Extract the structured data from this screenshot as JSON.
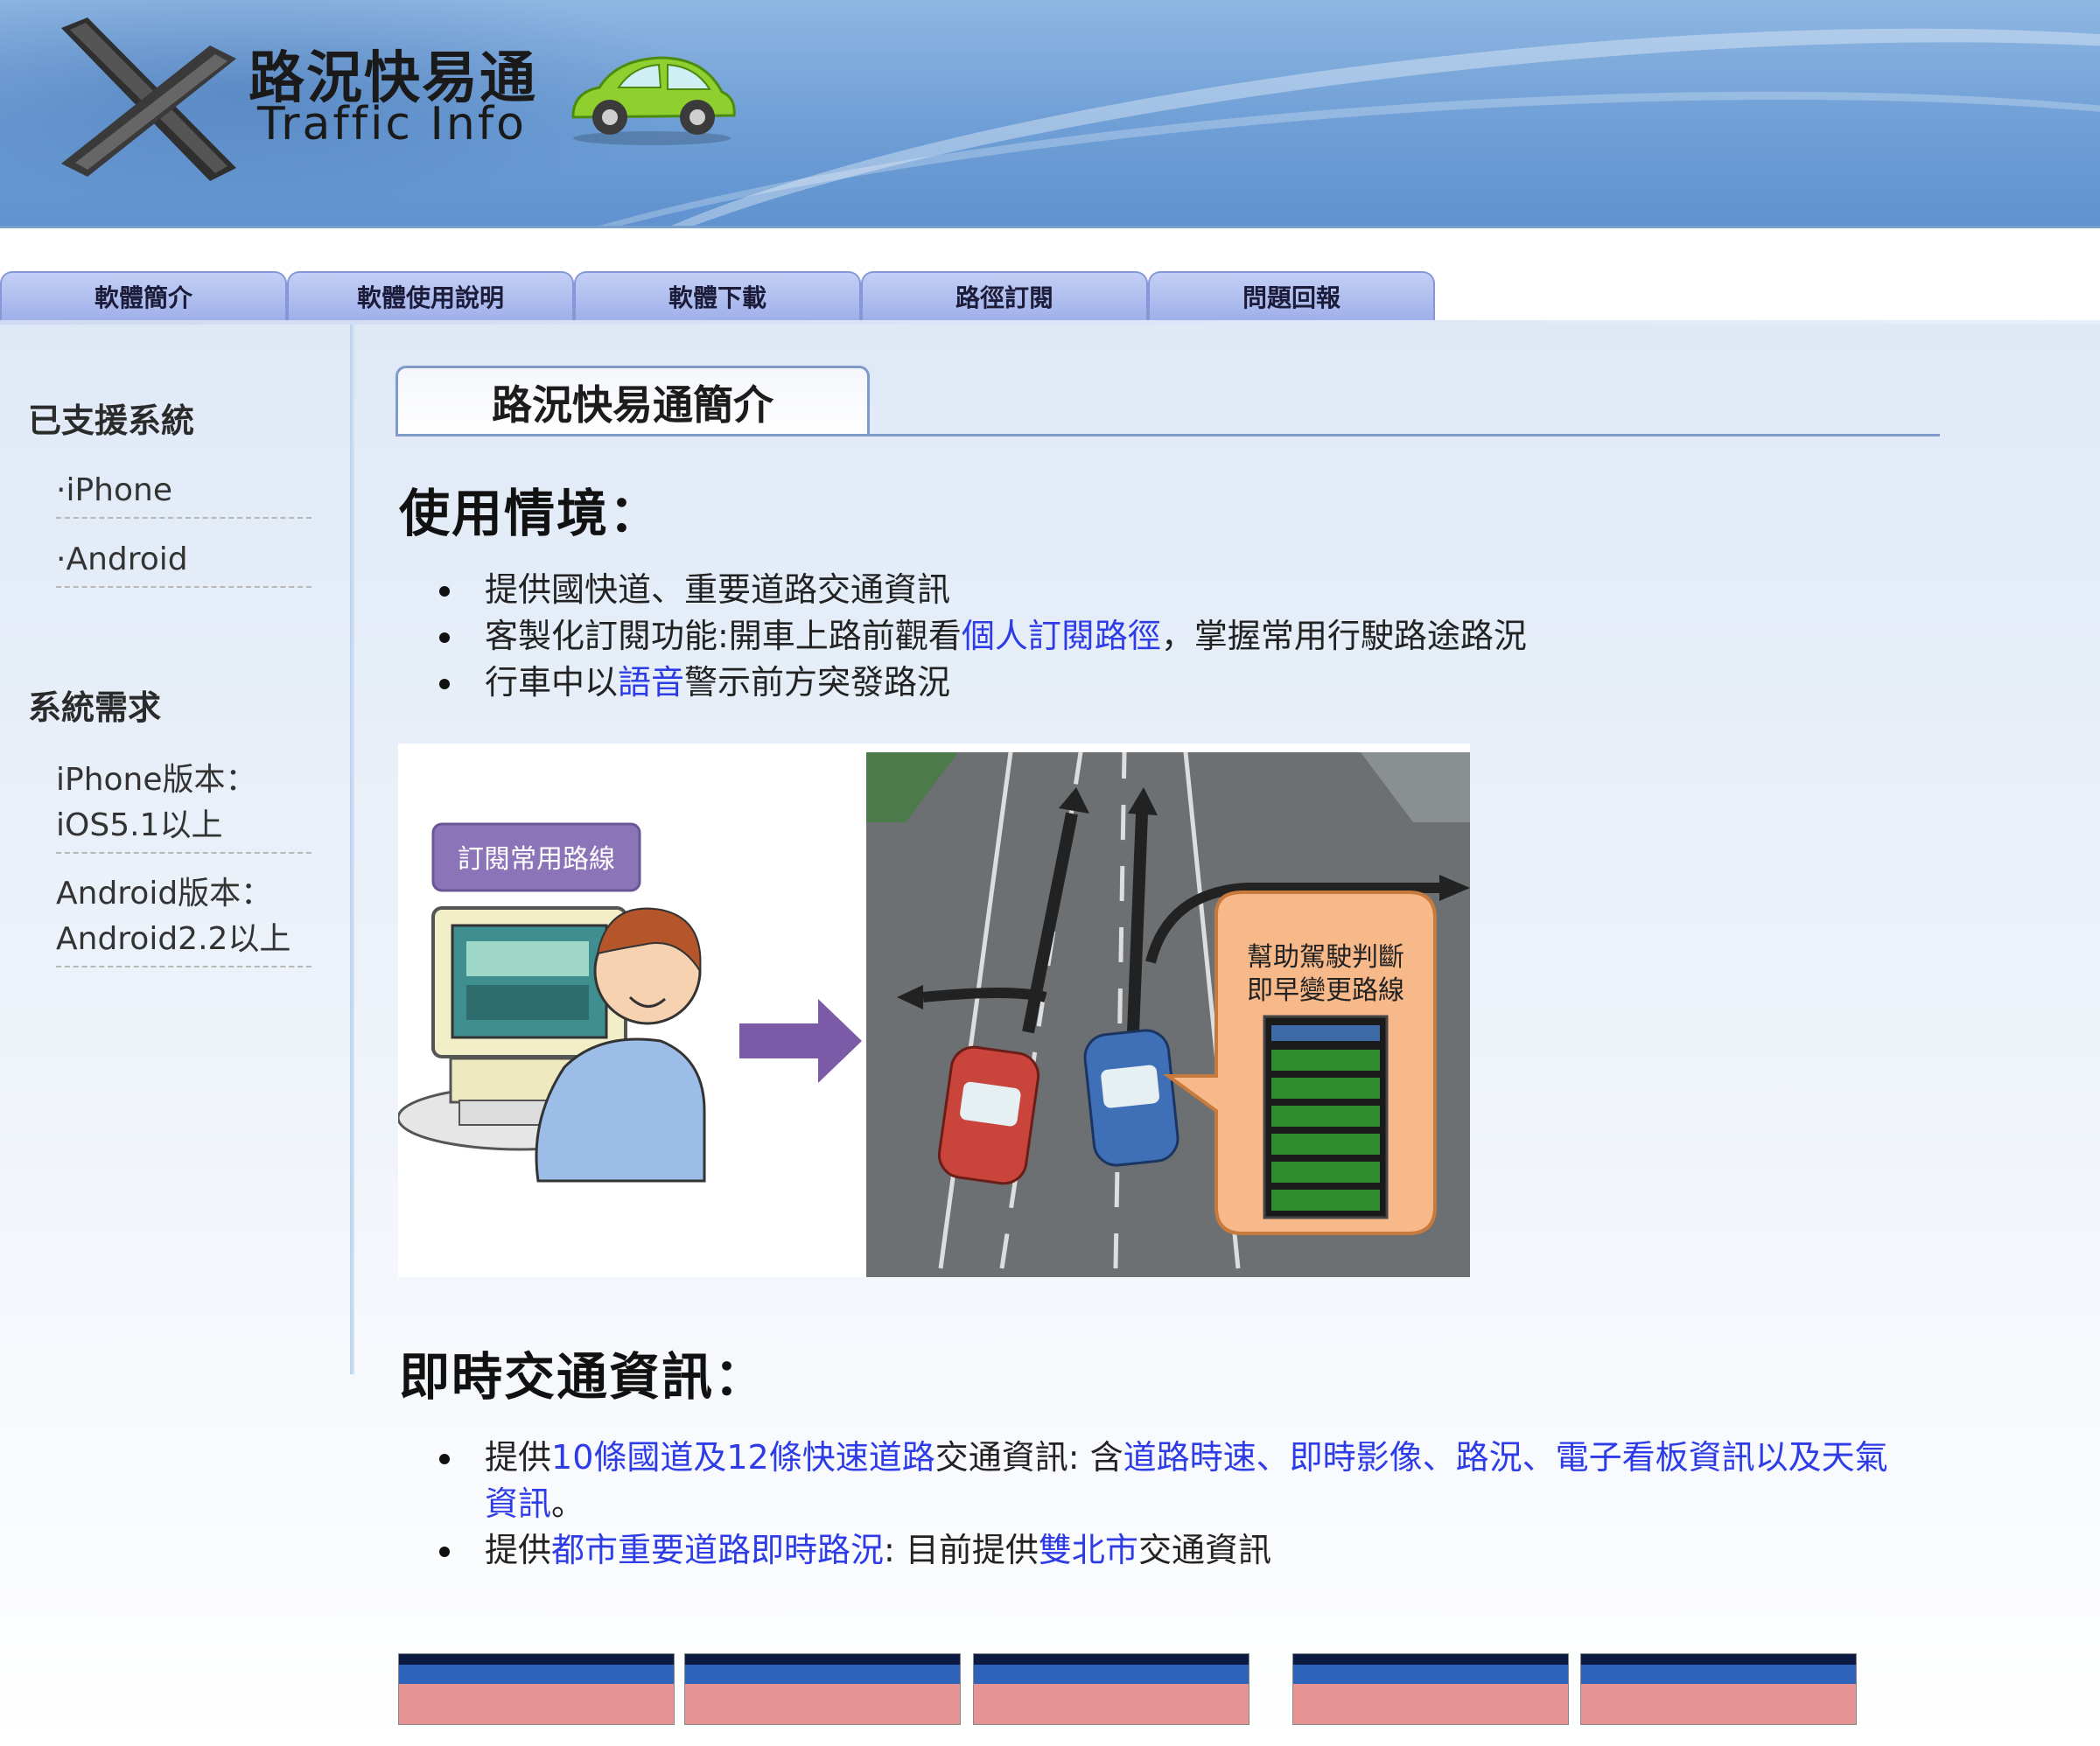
{
  "header": {
    "logo_cn": "路況快易通",
    "logo_en": "Traffic Info"
  },
  "nav": {
    "tabs": [
      {
        "label": "軟體簡介"
      },
      {
        "label": "軟體使用說明"
      },
      {
        "label": "軟體下載"
      },
      {
        "label": "路徑訂閱"
      },
      {
        "label": "問題回報"
      }
    ]
  },
  "sidebar": {
    "supported_heading": "已支援系統",
    "supported_items": [
      "·iPhone",
      "·Android"
    ],
    "requirements_heading": "系統需求",
    "requirements": [
      {
        "line1": "iPhone版本：",
        "line2": "iOS5.1以上"
      },
      {
        "line1": "Android版本：",
        "line2": "Android2.2以上"
      }
    ]
  },
  "main": {
    "title": "路況快易通簡介",
    "section1": {
      "heading": "使用情境：",
      "b1": "提供國快道、重要道路交通資訊",
      "b2_pre": "客製化訂閱功能:開車上路前觀看",
      "b2_link": "個人訂閱路徑",
      "b2_post": "，掌握常用行駛路途路況",
      "b3_pre": "行車中以",
      "b3_link": "語音",
      "b3_post": "警示前方突發路況"
    },
    "illustration": {
      "subscribe_label": "訂閱常用路線",
      "bubble_line1": "幫助駕駛判斷",
      "bubble_line2": "即早變更路線"
    },
    "section2": {
      "heading": "即時交通資訊：",
      "b1_pre": "提供",
      "b1_link1": "10條國道及12條快速道路",
      "b1_mid": "交通資訊: 含",
      "b1_link2": "道路時速、即時影像、路況、電子看板資訊以及天氣",
      "b1_link3": "資訊",
      "b1_end": "。",
      "b2_pre": "提供",
      "b2_link1": "都市重要道路即時路況",
      "b2_mid": ": 目前提供",
      "b2_link2": "雙北市",
      "b2_post": "交通資訊"
    }
  },
  "colors": {
    "link": "#2d3ce6",
    "nav_tab": "#a9b8ee",
    "banner": "#6f9fd6"
  }
}
